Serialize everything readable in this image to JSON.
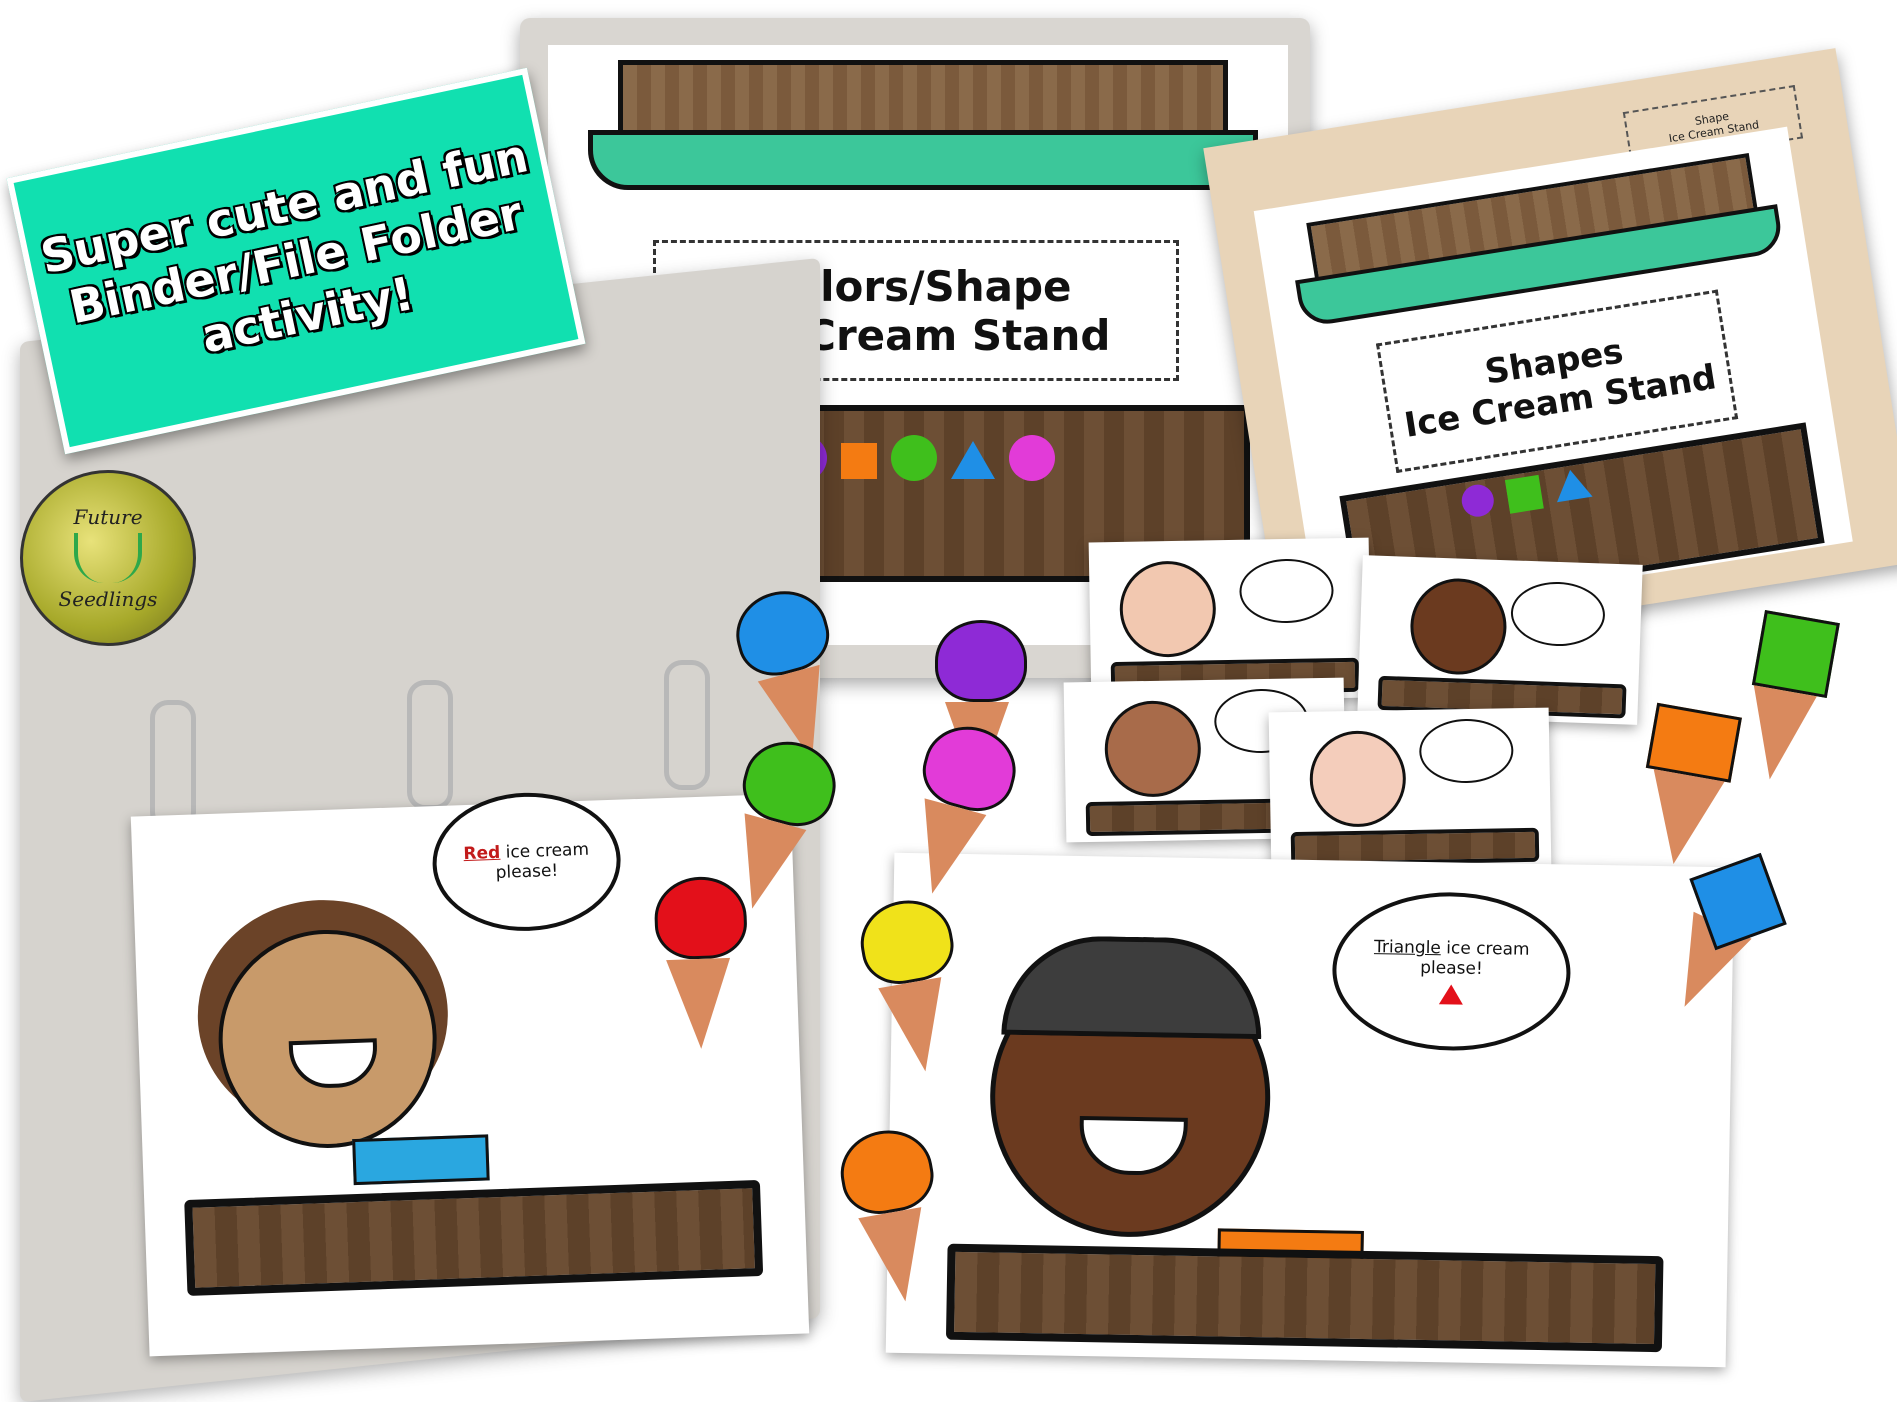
{
  "banner": {
    "lines": [
      "Super cute and fun",
      "Binder/File Folder",
      "activity!"
    ]
  },
  "logo": {
    "top": "Future",
    "bottom": "Seedlings"
  },
  "binder_cover": {
    "title_line1": "Colors/Shape",
    "title_line2": "Ice Cream Stand"
  },
  "file_folder": {
    "tab_line1": "Shape",
    "tab_line2": "Ice Cream Stand",
    "title_line1": "Shapes",
    "title_line2": "Ice Cream Stand"
  },
  "binder_page": {
    "speech_color_word": "Red",
    "speech_rest": "ice cream",
    "speech_line2": "please!"
  },
  "big_card": {
    "speech_shape_word": "Triangle",
    "speech_rest": "ice cream",
    "speech_line2": "please!"
  },
  "colors": {
    "banner": "#11e0b0",
    "awning": "#3cc79a",
    "wood": "#6d4f35",
    "cone": "#d98a5e",
    "red": "#e3101a",
    "blue": "#1f8fe6",
    "purple": "#8e2ad6",
    "pink": "#e23bd8",
    "green": "#3fbf1c",
    "yellow": "#f0e21a",
    "orange": "#f47b12"
  }
}
